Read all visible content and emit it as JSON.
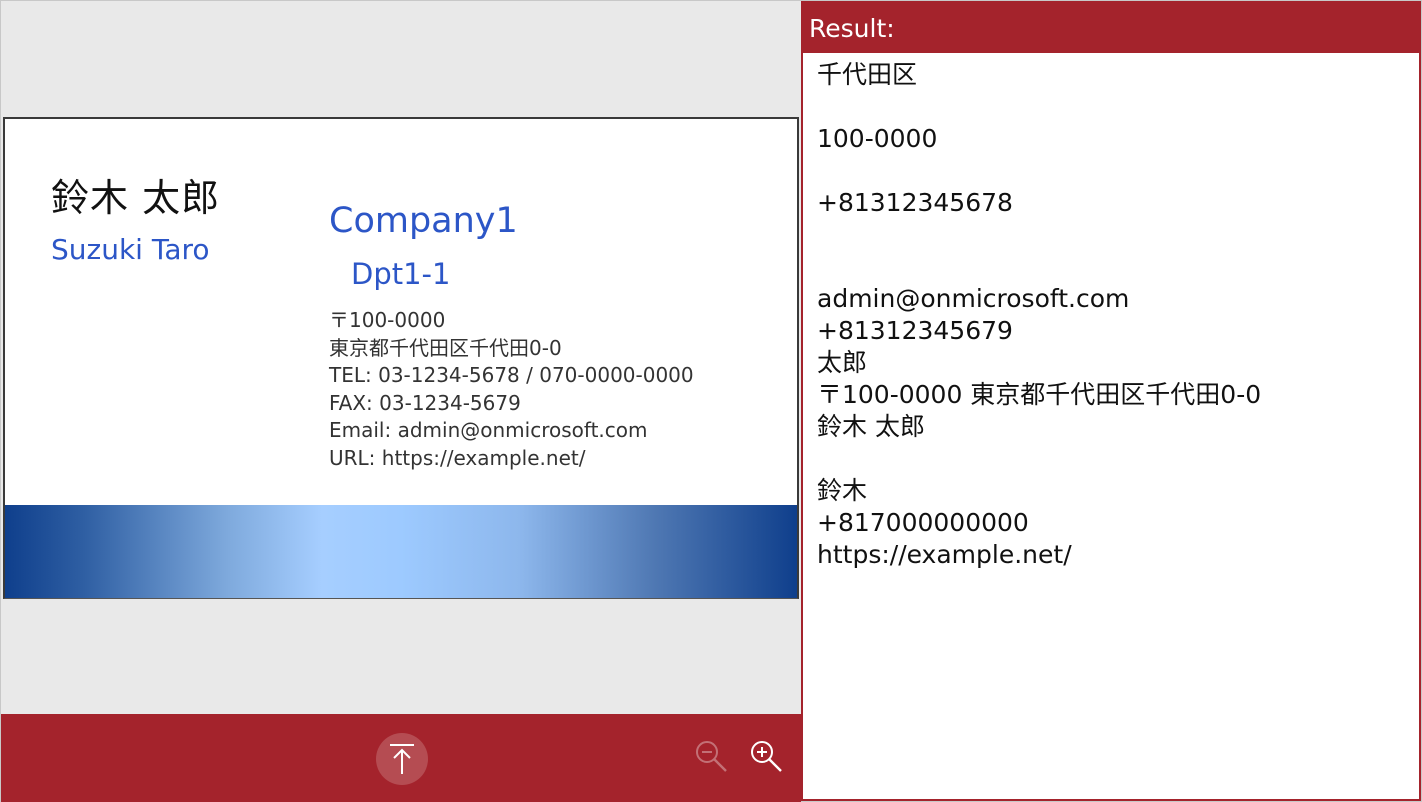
{
  "card": {
    "name_jp": "鈴木 太郎",
    "name_en": "Suzuki Taro",
    "company": "Company1",
    "department": "Dpt1-1",
    "details": [
      "〒100-0000",
      "東京都千代田区千代田0-0",
      "TEL: 03-1234-5678 / 070-0000-0000",
      "FAX: 03-1234-5679",
      "Email: admin@onmicrosoft.com",
      "URL: https://example.net/"
    ],
    "band_colors": [
      "#0f3f8c",
      "#a6ceff"
    ]
  },
  "toolbar": {
    "background": "#a4232c",
    "buttons": [
      {
        "icon": "upload-to-top-icon"
      },
      {
        "icon": "zoom-out-icon",
        "disabled": true
      },
      {
        "icon": "zoom-in-icon"
      }
    ]
  },
  "result": {
    "header": "Result:",
    "lines": [
      "千代田区",
      "",
      "100-0000",
      "",
      "+81312345678",
      "",
      "",
      "admin@onmicrosoft.com",
      "+81312345679",
      "太郎",
      "〒100-0000 東京都千代田区千代田0-0",
      "鈴木 太郎",
      "",
      "鈴木",
      "+817000000000",
      "https://example.net/"
    ]
  },
  "colors": {
    "accent": "#a4232c",
    "card_text_blue": "#2c56c7"
  }
}
